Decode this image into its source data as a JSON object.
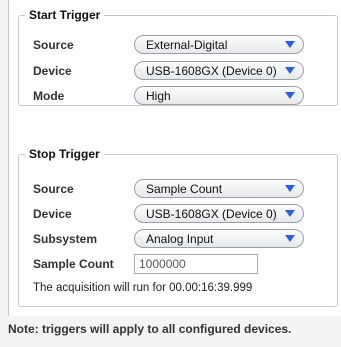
{
  "start_trigger": {
    "title": "Start Trigger",
    "source": {
      "label": "Source",
      "value": "External-Digital"
    },
    "device": {
      "label": "Device",
      "value": "USB-1608GX (Device 0)"
    },
    "mode": {
      "label": "Mode",
      "value": "High"
    }
  },
  "stop_trigger": {
    "title": "Stop Trigger",
    "source": {
      "label": "Source",
      "value": "Sample Count"
    },
    "device": {
      "label": "Device",
      "value": "USB-1608GX (Device 0)"
    },
    "subsystem": {
      "label": "Subsystem",
      "value": "Analog Input"
    },
    "sample_count": {
      "label": "Sample Count",
      "value": "1000000"
    },
    "run_info": "The acquisition will run for 00.00:16:39.999"
  },
  "note": "Note: triggers will apply to all configured devices.",
  "colors": {
    "accent": "#2a62d6",
    "border": "#c9c9c9"
  }
}
